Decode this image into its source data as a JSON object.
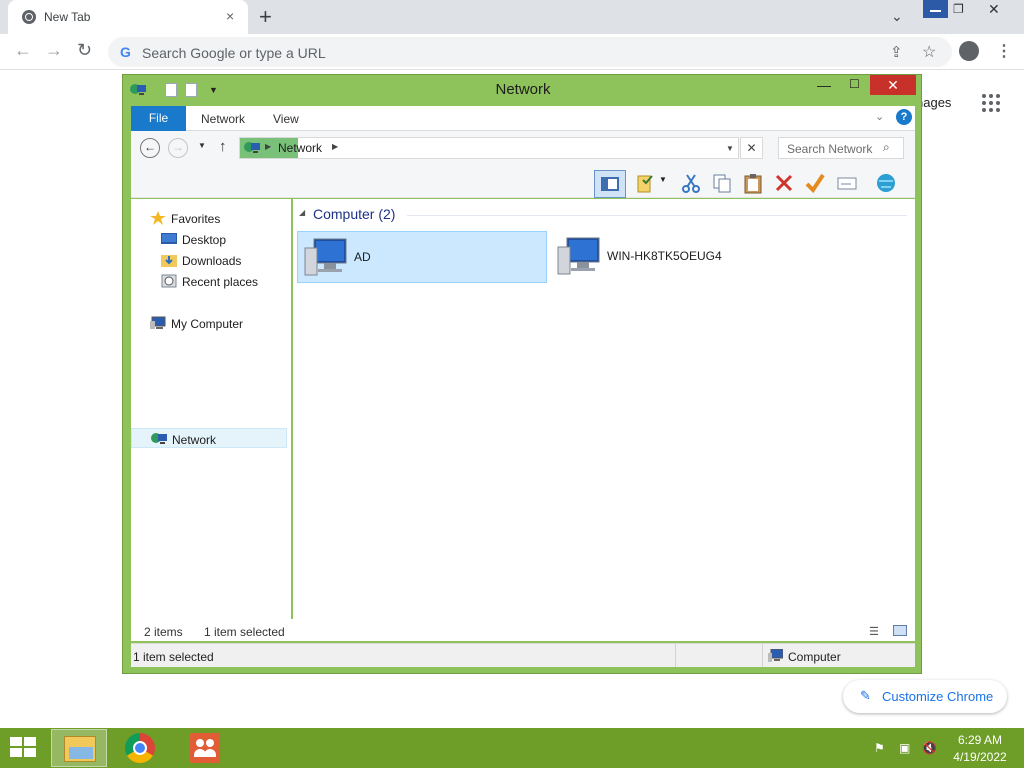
{
  "browser": {
    "tab_title": "New Tab",
    "tab_close": "×",
    "new_tab": "+",
    "omnibox_placeholder": "Search Google or type a URL",
    "omnibox_g": "G",
    "ntp_images_label": "nages",
    "customize_label": "Customize Chrome",
    "pencil": "✎",
    "nav_back": "←",
    "nav_forward": "→",
    "reload": "↻",
    "share": "⇪",
    "star": "☆",
    "menu": "⋮",
    "tab_search": "⌄",
    "win_max": "❐",
    "win_close": "✕"
  },
  "explorer": {
    "title": "Network",
    "ribbon_tabs": {
      "file": "File",
      "network": "Network",
      "view": "View"
    },
    "help": "?",
    "ribbon_chevron": "⌄",
    "min": "—",
    "max": "☐",
    "close": "✕",
    "back": "←",
    "forward": "→",
    "up": "↑",
    "dropdown": "▼",
    "address_sep": "▶",
    "address_text": "Network",
    "clear": "✕",
    "search_placeholder": "Search Network",
    "magnifier": "⌕",
    "nav": {
      "favorites": "Favorites",
      "desktop": "Desktop",
      "downloads": "Downloads",
      "recent": "Recent places",
      "my_computer": "My Computer",
      "network": "Network"
    },
    "group_arrow": "◢",
    "group_title": "Computer (2)",
    "items": [
      {
        "label": "AD",
        "selected": true
      },
      {
        "label": "WIN-HK8TK5OEUG4",
        "selected": false
      }
    ],
    "status": {
      "count": "2 items",
      "selected": "1 item selected",
      "details_left": "1 item selected",
      "details_right": "Computer"
    }
  },
  "taskbar": {
    "time": "6:29 AM",
    "date": "4/19/2022"
  },
  "colors": {
    "window_frame": "#8ec25a",
    "taskbar": "#6e9d28",
    "close_red": "#c7312a",
    "file_tab": "#1979ca",
    "selection": "#cce8ff"
  }
}
